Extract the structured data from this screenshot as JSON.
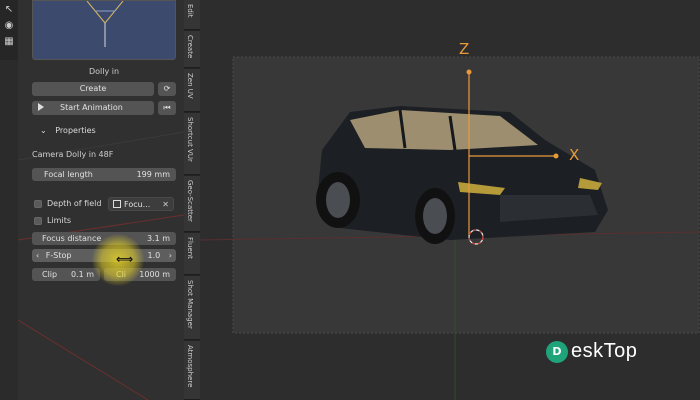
{
  "tool_strip": {
    "icons": [
      "cursor-icon",
      "camera-icon",
      "grid-icon"
    ]
  },
  "panel": {
    "thumbnail_caption": "Dolly in",
    "create_label": "Create",
    "start_animation_label": "Start Animation",
    "properties_label": "Properties",
    "camera_label": "Camera Dolly in 48F",
    "focal_length": {
      "label": "Focal length",
      "value": "199 mm"
    },
    "depth_of_field_label": "Depth of field",
    "focus_object_label": "Focu...",
    "limits_label": "Limits",
    "focus_distance": {
      "label": "Focus distance",
      "value": "3.1 m"
    },
    "fstop": {
      "label": "F-Stop",
      "value": "1.0"
    },
    "clip_start": {
      "label": "Clip",
      "value": "0.1 m"
    },
    "clip_end": {
      "label": "Cli",
      "value": "1000 m"
    }
  },
  "tabs": [
    "Edit",
    "Create",
    "Zen UV",
    "Shortcut VUr",
    "Geo-Scatter",
    "Fluent",
    "Shot Manager",
    "Atmosphere"
  ],
  "viewport": {
    "axis_z": "Z",
    "axis_x": "X",
    "gizmo_color": "#e89a3a"
  },
  "watermark": {
    "logo_letter": "D",
    "text": "eskTop"
  }
}
